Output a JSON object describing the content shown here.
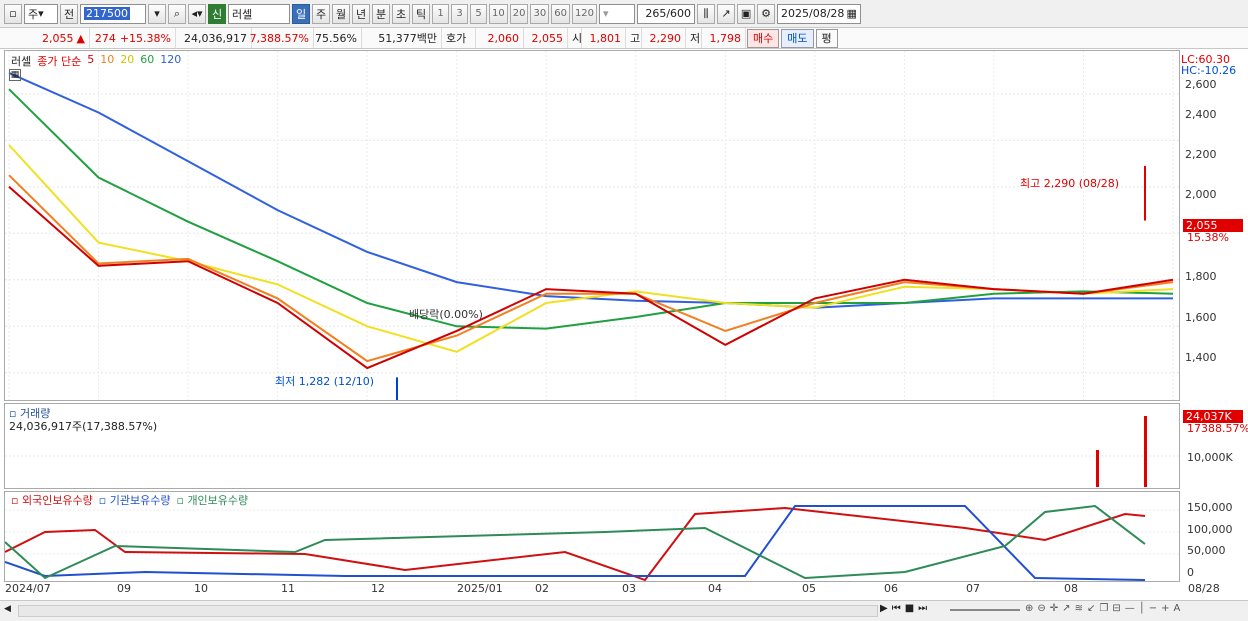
{
  "toolbar": {
    "type_select": "주",
    "prev_label": "전",
    "code": "217500",
    "name": "러셀",
    "new_badge": "신",
    "periods": [
      "일",
      "주",
      "월",
      "년",
      "분",
      "초",
      "틱"
    ],
    "active_period": "일",
    "intervals": [
      "1",
      "3",
      "5",
      "10",
      "20",
      "30",
      "60",
      "120"
    ],
    "count": "265",
    "count_total": "/600",
    "date": "2025/08/28"
  },
  "info": {
    "price": "2,055",
    "arrow": "▲",
    "change": "274",
    "change_pct": "+15.38%",
    "volume": "24,036,917",
    "volume_pct": "7,388.57%",
    "turnover": "75.56%",
    "amount": "51,377백만",
    "quote_label": "호가",
    "ask": "2,060",
    "bid": "2,055",
    "open_label": "시",
    "open": "1,801",
    "high_label": "고",
    "high": "2,290",
    "low_label": "저",
    "low": "1,798",
    "buy": "매수",
    "sell": "매도",
    "eval": "평"
  },
  "main_chart": {
    "legend_name": "러셀",
    "legend_title": "종가 단순",
    "ma_periods": [
      "5",
      "10",
      "20",
      "60",
      "120"
    ],
    "lc": "LC:60.30",
    "hc": "HC:-10.26",
    "y_ticks": [
      "2,600",
      "2,400",
      "2,200",
      "2,000",
      "1,800",
      "1,600",
      "1,400"
    ],
    "current_price": "2,055",
    "current_pct": "15.38%",
    "high_annot": "최고 2,290 (08/28)",
    "low_annot": "최저 1,282 (12/10)",
    "dividend_annot": "배당락(0.00%)"
  },
  "volume_chart": {
    "title": "거래량",
    "subtitle": "24,036,917주(17,388.57%)",
    "current": "24,037K",
    "current_pct": "17388.57%",
    "y_tick": "10,000K"
  },
  "investor_chart": {
    "series": [
      "외국인보유수량",
      "기관보유수량",
      "개인보유수량"
    ],
    "series_colors": [
      "#d01010",
      "#2050d0",
      "#2e8b57"
    ],
    "y_ticks": [
      "150,000",
      "100,000",
      "50,000",
      "0"
    ]
  },
  "x_axis": [
    "2024/07",
    "09",
    "10",
    "11",
    "12",
    "2025/01",
    "02",
    "03",
    "04",
    "05",
    "06",
    "07",
    "08",
    "08/28"
  ],
  "colors": {
    "ma5": "#d00000",
    "ma10": "#f08020",
    "ma20": "#f0e020",
    "ma60": "#20a040",
    "ma120": "#3060e0",
    "up": "#e00000",
    "down": "#0040d0"
  },
  "chart_data": {
    "type": "line",
    "x": [
      "2024/07",
      "09",
      "10",
      "11",
      "12",
      "2025/01",
      "02",
      "03",
      "04",
      "05",
      "06",
      "07",
      "08",
      "08/28"
    ],
    "series": [
      {
        "name": "5",
        "values": [
          2200,
          1860,
          1880,
          1700,
          1420,
          1580,
          1760,
          1740,
          1520,
          1720,
          1800,
          1760,
          1740,
          1800
        ]
      },
      {
        "name": "10",
        "values": [
          2250,
          1870,
          1890,
          1720,
          1450,
          1560,
          1740,
          1740,
          1580,
          1700,
          1790,
          1760,
          1740,
          1790
        ]
      },
      {
        "name": "20",
        "values": [
          2380,
          1960,
          1880,
          1780,
          1600,
          1490,
          1700,
          1750,
          1700,
          1680,
          1770,
          1760,
          1740,
          1760
        ]
      },
      {
        "name": "60",
        "values": [
          2620,
          2240,
          2050,
          1880,
          1700,
          1600,
          1590,
          1640,
          1700,
          1700,
          1700,
          1740,
          1750,
          1740
        ]
      },
      {
        "name": "120",
        "values": [
          2690,
          2520,
          2310,
          2100,
          1920,
          1790,
          1730,
          1710,
          1700,
          1680,
          1700,
          1720,
          1720,
          1720
        ]
      }
    ],
    "ylim": [
      1300,
      2750
    ]
  }
}
